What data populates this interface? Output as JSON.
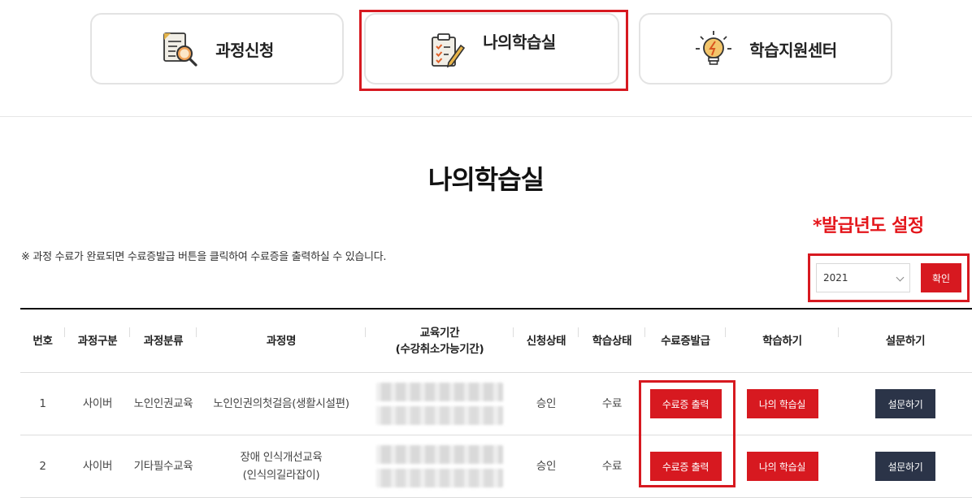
{
  "tabs": [
    {
      "label": "과정신청",
      "icon": "document-search-icon"
    },
    {
      "label": "나의학습실",
      "icon": "clipboard-pencil-icon"
    },
    {
      "label": "학습지원센터",
      "icon": "lightbulb-icon"
    }
  ],
  "page_title": "나의학습실",
  "annotation": "*발급년도 설정",
  "notice": "※ 과정 수료가 완료되면 수료증발급 버튼을 클릭하여 수료증을 출력하실 수 있습니다.",
  "year_filter": {
    "selected": "2021",
    "confirm_label": "확인"
  },
  "table": {
    "headers": [
      "번호",
      "과정구분",
      "과정분류",
      "과정명",
      "교육기간\n(수강취소가능기간)",
      "신청상태",
      "학습상태",
      "수료증발급",
      "학습하기",
      "설문하기"
    ],
    "rows": [
      {
        "no": "1",
        "type": "사이버",
        "category": "노인인권교육",
        "name": "노인인권의첫걸음(생활시설편)",
        "apply_status": "승인",
        "learn_status": "수료",
        "cert_label": "수료증 출력",
        "study_label": "나의 학습실",
        "survey_label": "설문하기"
      },
      {
        "no": "2",
        "type": "사이버",
        "category": "기타필수교육",
        "name": "장애 인식개선교육\n(인식의길라잡이)",
        "apply_status": "승인",
        "learn_status": "수료",
        "cert_label": "수료증 출력",
        "study_label": "나의 학습실",
        "survey_label": "설문하기"
      }
    ]
  },
  "colors": {
    "accent_red": "#d71920",
    "annotation_red": "#e4161b",
    "navy": "#2b3448"
  }
}
